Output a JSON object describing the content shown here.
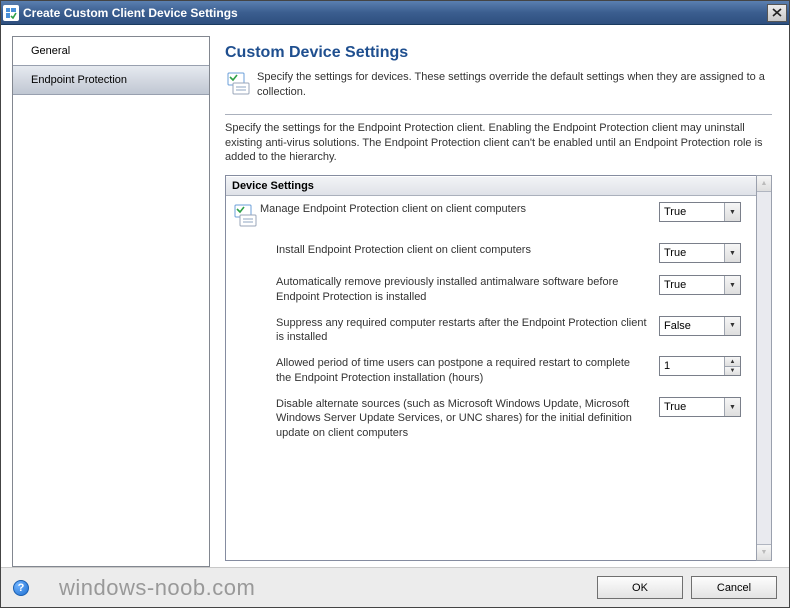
{
  "titlebar": {
    "title": "Create Custom Client Device Settings"
  },
  "sidebar": {
    "items": [
      {
        "label": "General",
        "selected": false
      },
      {
        "label": "Endpoint Protection",
        "selected": true
      }
    ]
  },
  "main": {
    "heading": "Custom Device Settings",
    "intro": "Specify the settings for devices. These settings override the default settings when they are assigned to a collection.",
    "description": "Specify the settings for the Endpoint Protection client. Enabling the Endpoint Protection client may uninstall existing anti-virus solutions. The Endpoint Protection client can't be enabled until an Endpoint Protection role is added to the hierarchy.",
    "section_header": "Device Settings",
    "settings": [
      {
        "label": "Manage Endpoint Protection client on client computers",
        "value": "True",
        "type": "combo",
        "top": true
      },
      {
        "label": "Install Endpoint Protection client on client computers",
        "value": "True",
        "type": "combo"
      },
      {
        "label": "Automatically remove previously installed antimalware software before Endpoint Protection is installed",
        "value": "True",
        "type": "combo"
      },
      {
        "label": "Suppress any required computer restarts after the Endpoint Protection client is installed",
        "value": "False",
        "type": "combo"
      },
      {
        "label": "Allowed period of time users can postpone a required restart to complete the Endpoint Protection installation (hours)",
        "value": "1",
        "type": "spin"
      },
      {
        "label": "Disable alternate sources (such as Microsoft Windows Update, Microsoft Windows Server Update Services, or UNC shares) for the initial definition update on client computers",
        "value": "True",
        "type": "combo"
      }
    ]
  },
  "footer": {
    "ok_label": "OK",
    "cancel_label": "Cancel",
    "watermark": "windows-noob.com"
  }
}
